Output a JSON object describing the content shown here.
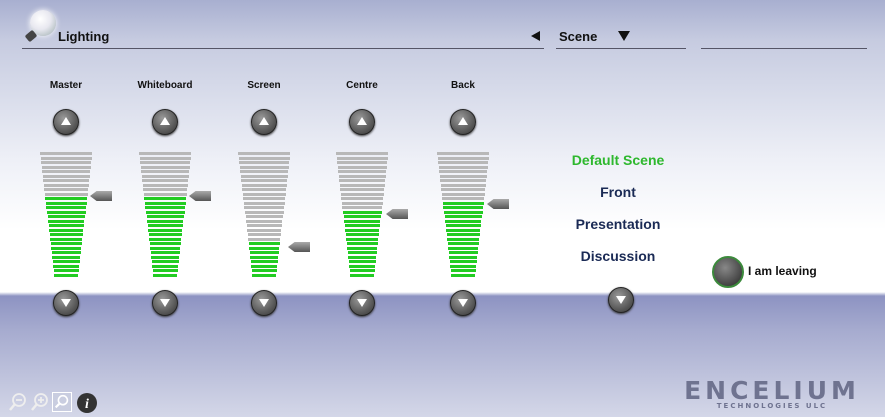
{
  "header": {
    "title": "Lighting",
    "scene_label": "Scene",
    "icons": {
      "bulb": "lightbulb-icon",
      "prev": "arrow-left-icon",
      "dropdown": "arrow-down-icon"
    }
  },
  "channels": [
    {
      "label": "Master",
      "level": 0.66
    },
    {
      "label": "Whiteboard",
      "level": 0.66
    },
    {
      "label": "Screen",
      "level": 0.27
    },
    {
      "label": "Centre",
      "level": 0.52
    },
    {
      "label": "Back",
      "level": 0.6
    }
  ],
  "colors": {
    "fill_green": "#22cc22",
    "empty_gray": "#b8b8b8",
    "active_scene": "#2eb82e"
  },
  "scenes": {
    "items": [
      "Default Scene",
      "Front",
      "Presentation",
      "Discussion"
    ],
    "active_index": 0
  },
  "leave": {
    "label": "I am leaving"
  },
  "toolbar": {
    "icons": [
      "zoom-out-icon",
      "zoom-in-icon",
      "search-icon",
      "info-icon"
    ]
  },
  "brand": {
    "name": "ENCELIUM",
    "sub": "TECHNOLOGIES ULC"
  }
}
